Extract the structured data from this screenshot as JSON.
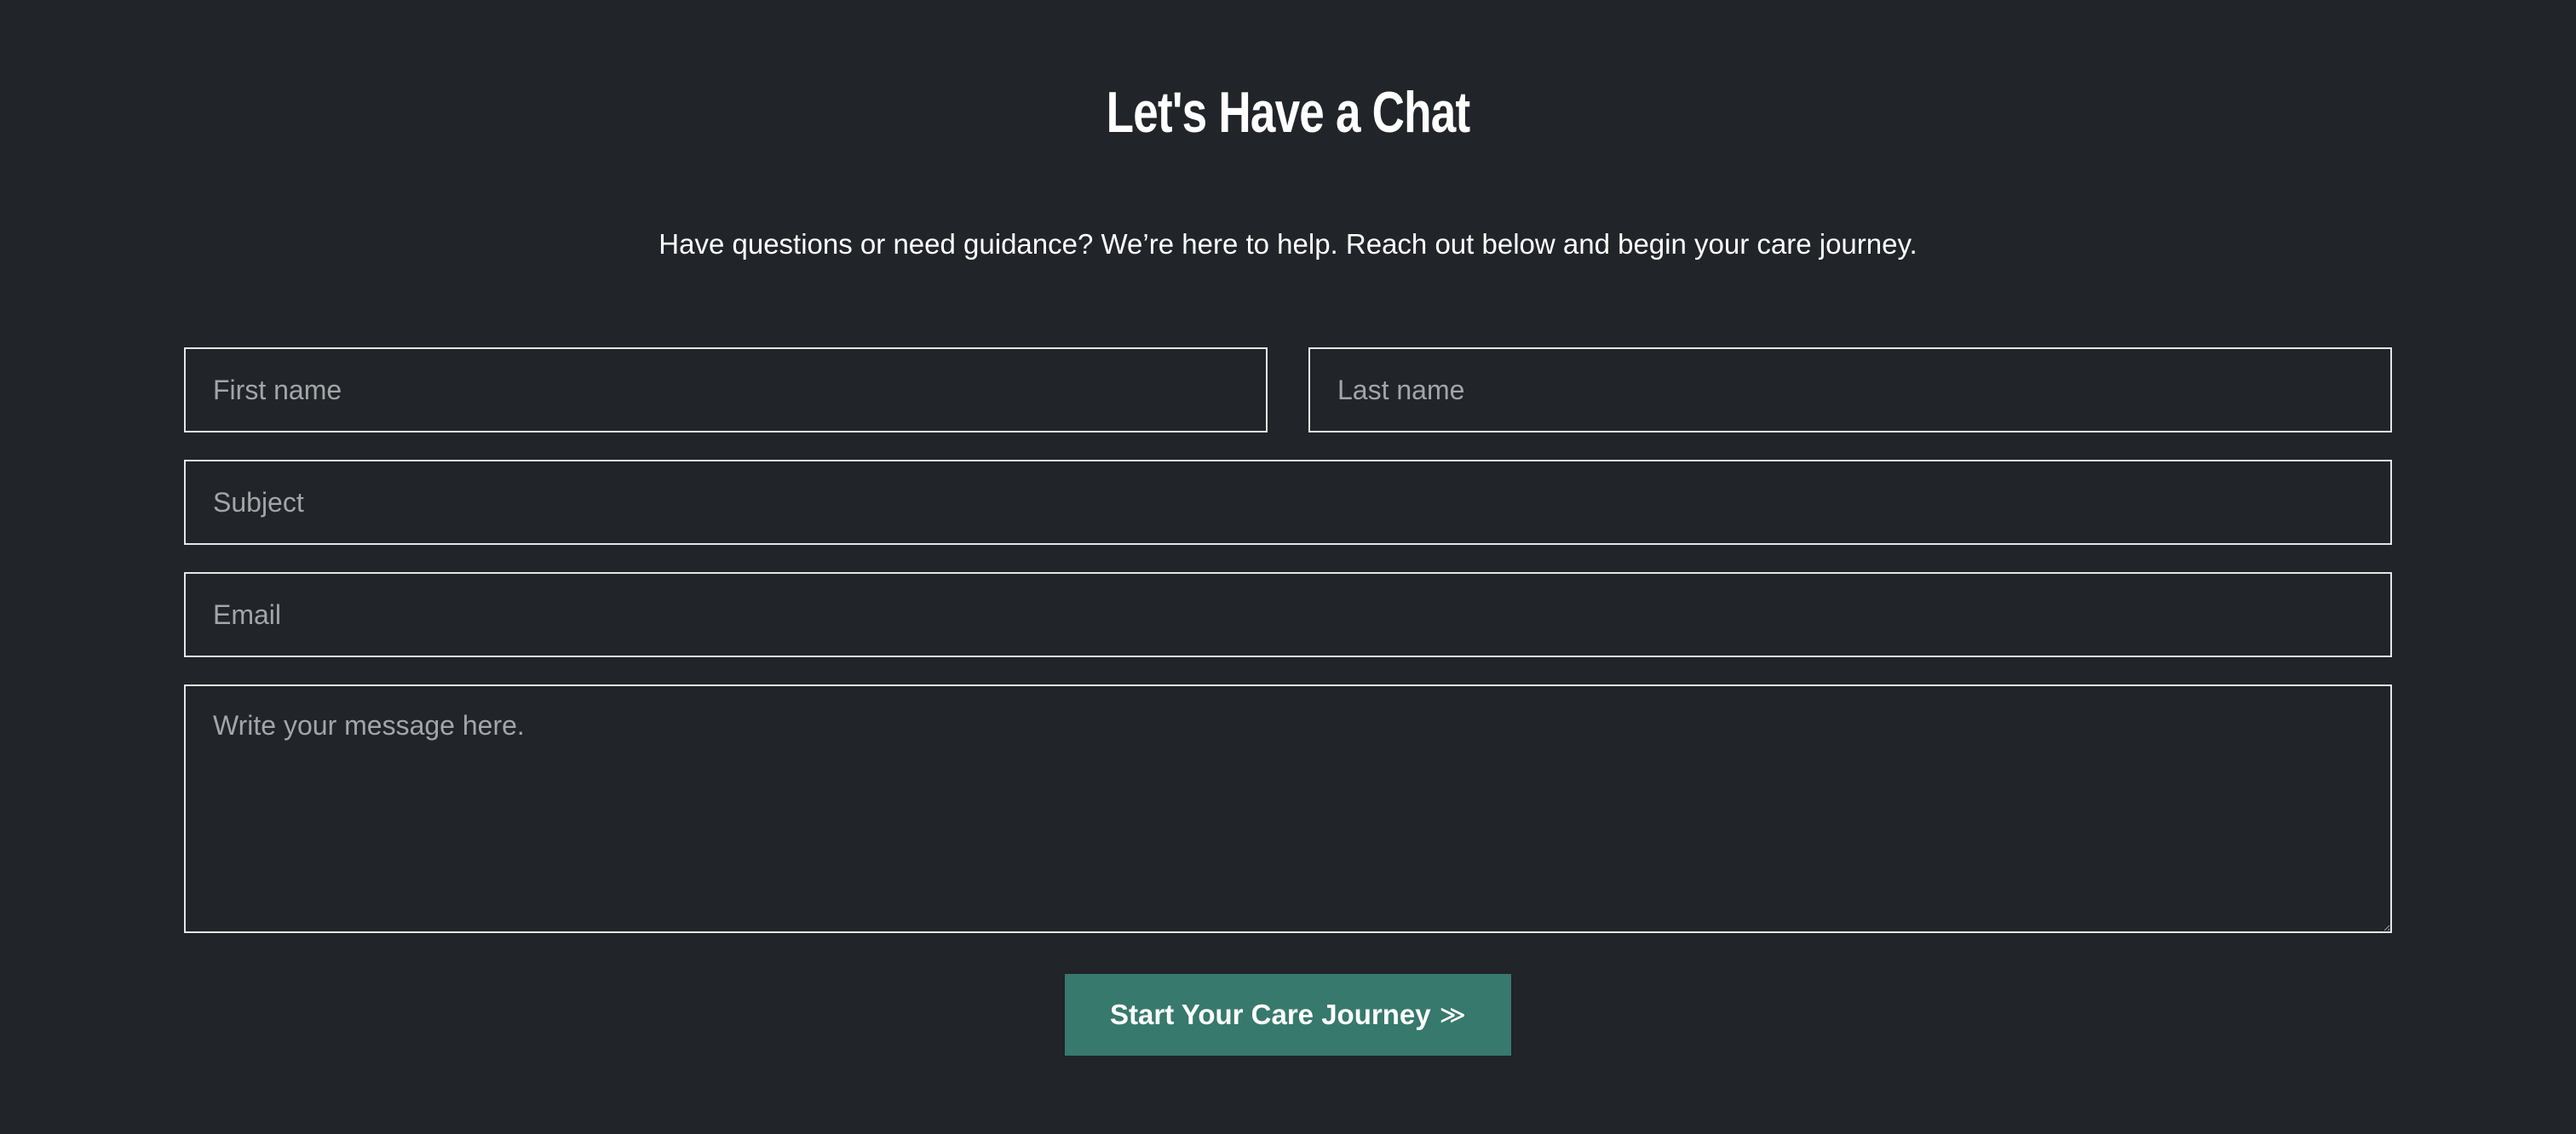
{
  "contact": {
    "title": "Let's Have a Chat",
    "subtitle": "Have questions or need guidance? We’re here to help. Reach out below and begin your care journey."
  },
  "form": {
    "first_name": {
      "placeholder": "First name",
      "value": ""
    },
    "last_name": {
      "placeholder": "Last name",
      "value": ""
    },
    "subject": {
      "placeholder": "Subject",
      "value": ""
    },
    "email": {
      "placeholder": "Email",
      "value": ""
    },
    "message": {
      "placeholder": "Write your message here.",
      "value": ""
    },
    "submit_label": "Start Your Care Journey",
    "submit_icon": "double-chevron-right-icon",
    "submit_icon_glyph": "≫"
  },
  "colors": {
    "background": "#212428",
    "button": "#37796c",
    "text": "#ffffff",
    "placeholder": "#a3a5a8",
    "border": "#e6e6e6"
  }
}
